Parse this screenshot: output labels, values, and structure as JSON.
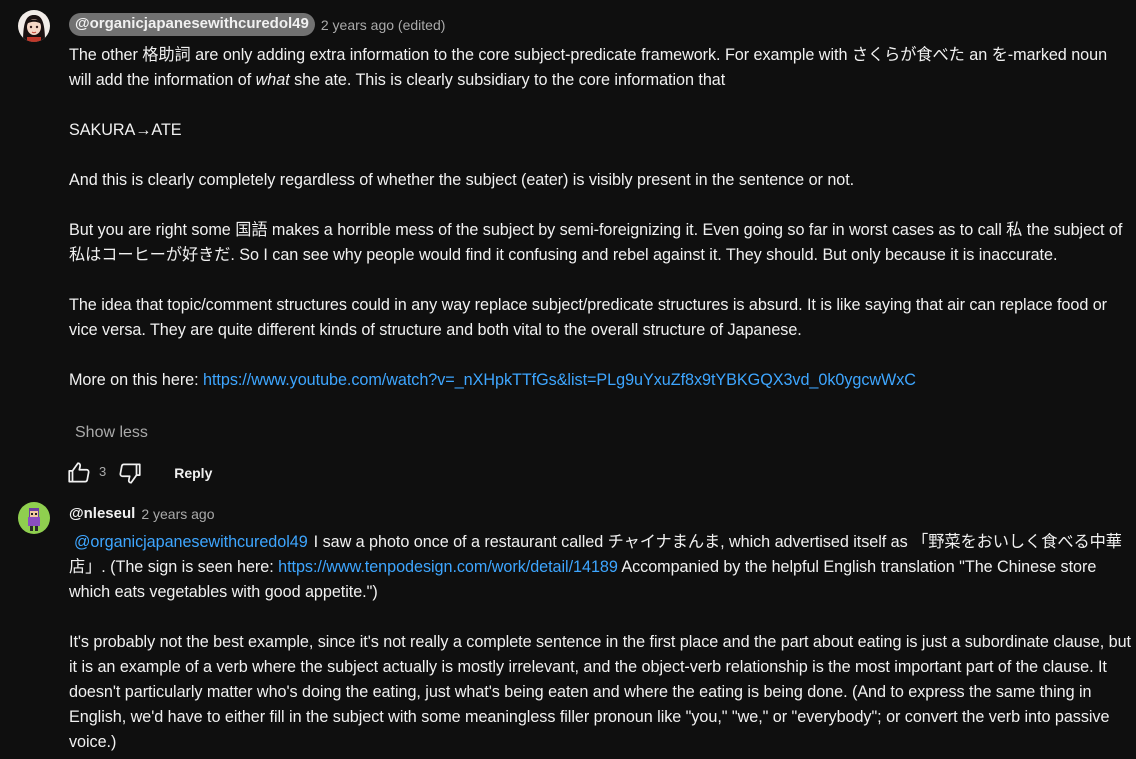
{
  "comment1": {
    "handle": "@organicjapanesewithcuredol49",
    "time": "2 years ago (edited)",
    "p1a": "The other 格助詞 are only adding extra information to the core subject-predicate framework. For example with さくらが食べた an を-marked noun will add the information of ",
    "p1em": "what",
    "p1b": " she ate. This is clearly subsidiary to the core information that",
    "p2": "SAKURA→ATE",
    "p3": "And this is clearly completely regardless of whether the subject (eater) is visibly present in the sentence or not.",
    "p4": "But you are right some 国語 makes a horrible mess of the subject by semi-foreignizing it. Even going so far in worst cases as to call 私 the subject of 私はコーヒーが好きだ. So I can see why people would find it confusing and rebel against it. They should. But only because it is inaccurate.",
    "p5": "The idea that topic/comment structures could in any way replace subject/predicate structures is absurd. It is like saying that air can replace food or vice versa. They are quite different kinds of structure and both vital to the overall structure of Japanese.",
    "p6_prefix": "More on this here: ",
    "p6_link": "https://www.youtube.com/watch?v=_nXHpkTTfGs&list=PLg9uYxuZf8x9tYBKGQX3vd_0k0ygcwWxC",
    "show_less": "Show less",
    "like_count": "3",
    "reply_label": "Reply"
  },
  "comment2": {
    "handle": "@nleseul",
    "time": "2 years ago",
    "mention": "@organicjapanesewithcuredol49",
    "p1a": "I saw a photo once of a restaurant called チャイナまんま, which advertised itself as 「野菜をおいしく食べる中華店」. (The sign is seen here: ",
    "p1_link": "https://www.tenpodesign.com/work/detail/14189",
    "p1b": " Accompanied by the helpful English translation \"The Chinese store which eats vegetables with good appetite.\")",
    "p2": "It's probably not the best example, since it's not really a complete sentence in the first place and the part about eating is just a subordinate clause, but it is an example of a verb where the subject actually is mostly irrelevant, and the object-verb relationship is the most important part of the clause. It doesn't particularly matter who's doing the eating, just what's being eaten and where the eating is being done. (And to express the same thing in English, we'd have to either fill in the subject with some meaningless filler pronoun like \"you,\" \"we,\" or \"everybody\"; or convert the verb into passive voice.)"
  },
  "colors": {
    "background": "#0f0f0f",
    "text": "#f1f1f1",
    "secondary": "#aaaaaa",
    "link": "#3ea6ff",
    "chip": "#717171"
  },
  "icons": {
    "like": "thumbs-up-icon",
    "dislike": "thumbs-down-icon"
  }
}
